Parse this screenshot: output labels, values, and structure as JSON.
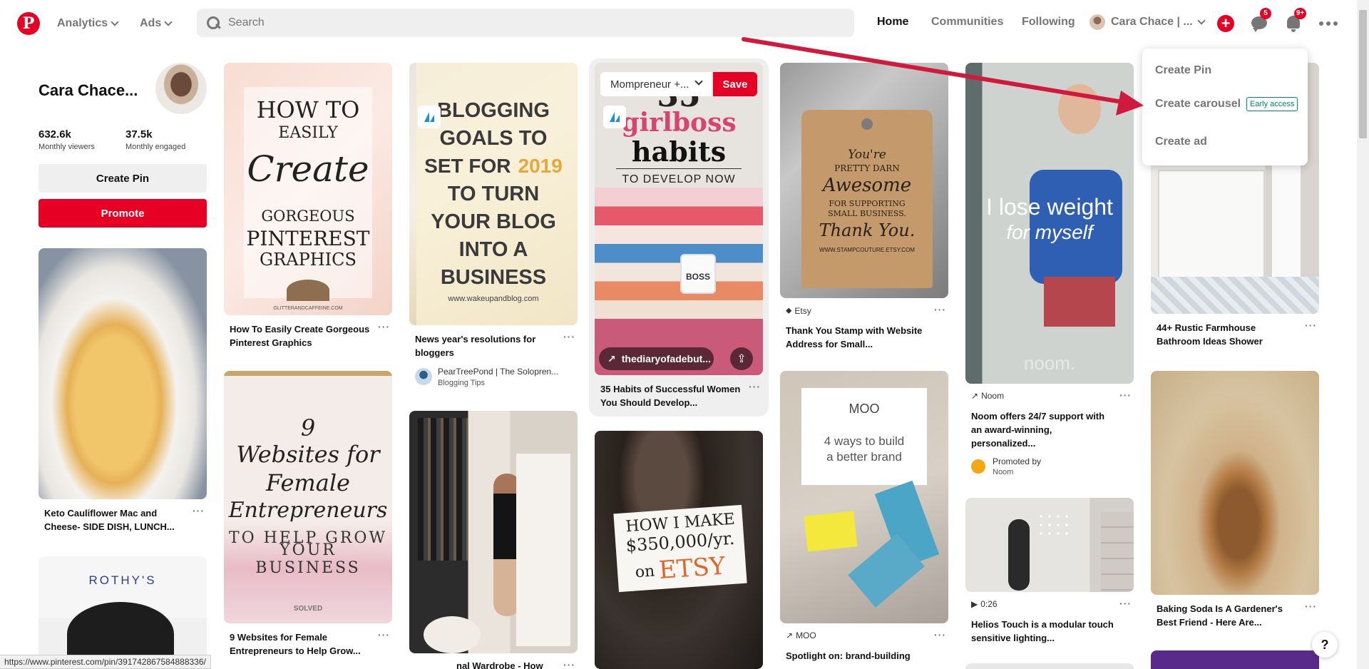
{
  "header": {
    "logo": "P",
    "analytics": "Analytics",
    "ads": "Ads",
    "search_placeholder": "Search",
    "nav": {
      "home": "Home",
      "communities": "Communities",
      "following": "Following"
    },
    "profile_chip": "Cara Chace | ...",
    "plus": "+",
    "messages_badge": "5",
    "notifications_badge": "9+"
  },
  "profile": {
    "name": "Cara Chace...",
    "viewers_value": "632.6k",
    "viewers_label": "Monthly viewers",
    "engaged_value": "37.5k",
    "engaged_label": "Monthly engaged",
    "create_pin": "Create Pin",
    "promote": "Promote"
  },
  "menu": {
    "create_pin": "Create Pin",
    "create_carousel": "Create carousel",
    "early_access": "Early access",
    "create_ad": "Create ad"
  },
  "pins": {
    "c1": {
      "p1_title": "Keto Cauliflower Mac and Cheese- SIDE DISH, LUNCH...",
      "p2_logo": "ROTHY'S"
    },
    "c2": {
      "p1_img": [
        "HOW TO",
        "EASILY",
        "Create",
        "GORGEOUS",
        "PINTEREST",
        "GRAPHICS",
        "GLITTERANDCAFFEINE.COM"
      ],
      "p1_title": "How To Easily Create Gorgeous Pinterest Graphics",
      "p2_img": [
        "9",
        "Websites for",
        "Female",
        "Entrepreneurs",
        "TO HELP GROW",
        "YOUR BUSINESS",
        "SOLVED"
      ],
      "p2_title": "9 Websites for Female Entrepreneurs to Help Grow..."
    },
    "c3": {
      "p1_img": [
        "BLOGGING",
        "GOALS TO",
        "SET FOR",
        "2019",
        "TO TURN",
        "YOUR BLOG",
        "INTO A",
        "BUSINESS",
        "www.wakeupandblog.com"
      ],
      "p1_title": "News year's resolutions for bloggers",
      "p1_user": "PearTreePond | The Solopren...",
      "p1_board": "Blogging Tips",
      "p2_title": "nal Wardrobe - How"
    },
    "c4": {
      "board_select": "Mompreneur +...",
      "save": "Save",
      "p1_img": [
        "35",
        "girlboss",
        "habits",
        "TO DEVELOP NOW",
        "BOSS"
      ],
      "link": "thediaryofadebut...",
      "p1_title": "35 Habits of Successful Women You Should Develop...",
      "p2_img": [
        "HOW I MAKE",
        "$350,000/yr.",
        "on",
        "ETSY"
      ]
    },
    "c5": {
      "p1_img": [
        "You're",
        "PRETTY DARN",
        "Awesome",
        "FOR SUPPORTING",
        "SMALL BUSINESS.",
        "Thank You.",
        "WWW.STAMPCOUTURE.ETSY.COM"
      ],
      "p1_source": "Etsy",
      "p1_title": "Thank You Stamp with Website Address for Small...",
      "p2_img": [
        "MOO",
        "4 ways to build",
        "a better brand"
      ],
      "p2_source": "MOO",
      "p2_title": "Spotlight on: brand-building"
    },
    "c6": {
      "p1_img": [
        "I lose weight",
        "for myself",
        "noom."
      ],
      "p1_source": "Noom",
      "p1_title": "Noom offers 24/7 support with an award-winning, personalized...",
      "p1_promoted": "Promoted by",
      "p1_promoter": "Noom",
      "p2_duration": "0:26",
      "p2_title": "Helios Touch is a modular touch sensitive lighting..."
    },
    "c7": {
      "p1_title": "44+ Rustic Farmhouse Bathroom Ideas Shower",
      "p2_title": "Baking Soda Is A Gardener's Best Friend - Here Are..."
    }
  },
  "dots": "···",
  "status_url": "https://www.pinterest.com/pin/391742867584888336/",
  "help": "?",
  "colors": {
    "brand_red": "#e60023",
    "gray_text": "#767676",
    "early_access_green": "#00856f"
  }
}
